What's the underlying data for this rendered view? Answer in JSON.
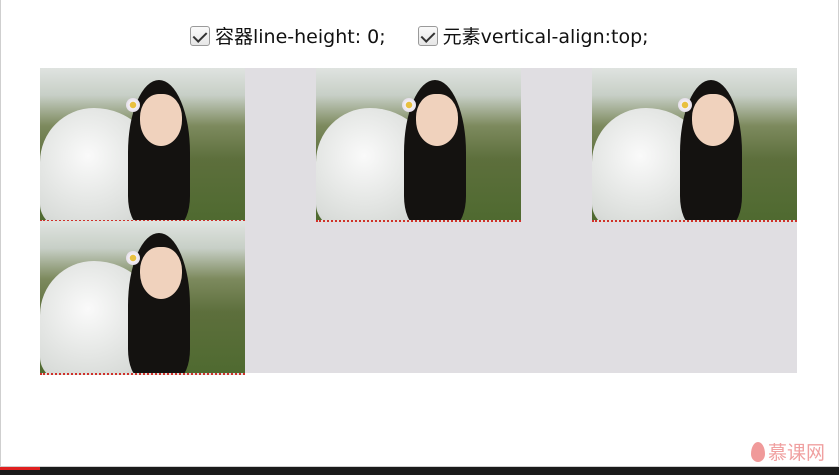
{
  "controls": [
    {
      "label": "容器line-height: 0;",
      "checked": true
    },
    {
      "label": "元素vertical-align:top;",
      "checked": true
    }
  ],
  "images": [
    {
      "row": 1,
      "col": 1
    },
    {
      "row": 1,
      "col": 2
    },
    {
      "row": 1,
      "col": 3
    },
    {
      "row": 2,
      "col": 1
    }
  ],
  "watermark": "慕课网",
  "colors": {
    "container": "#e0dee2",
    "underline": "#d0302a",
    "watermark": "#f0a0a0",
    "progress": "#e02020"
  }
}
